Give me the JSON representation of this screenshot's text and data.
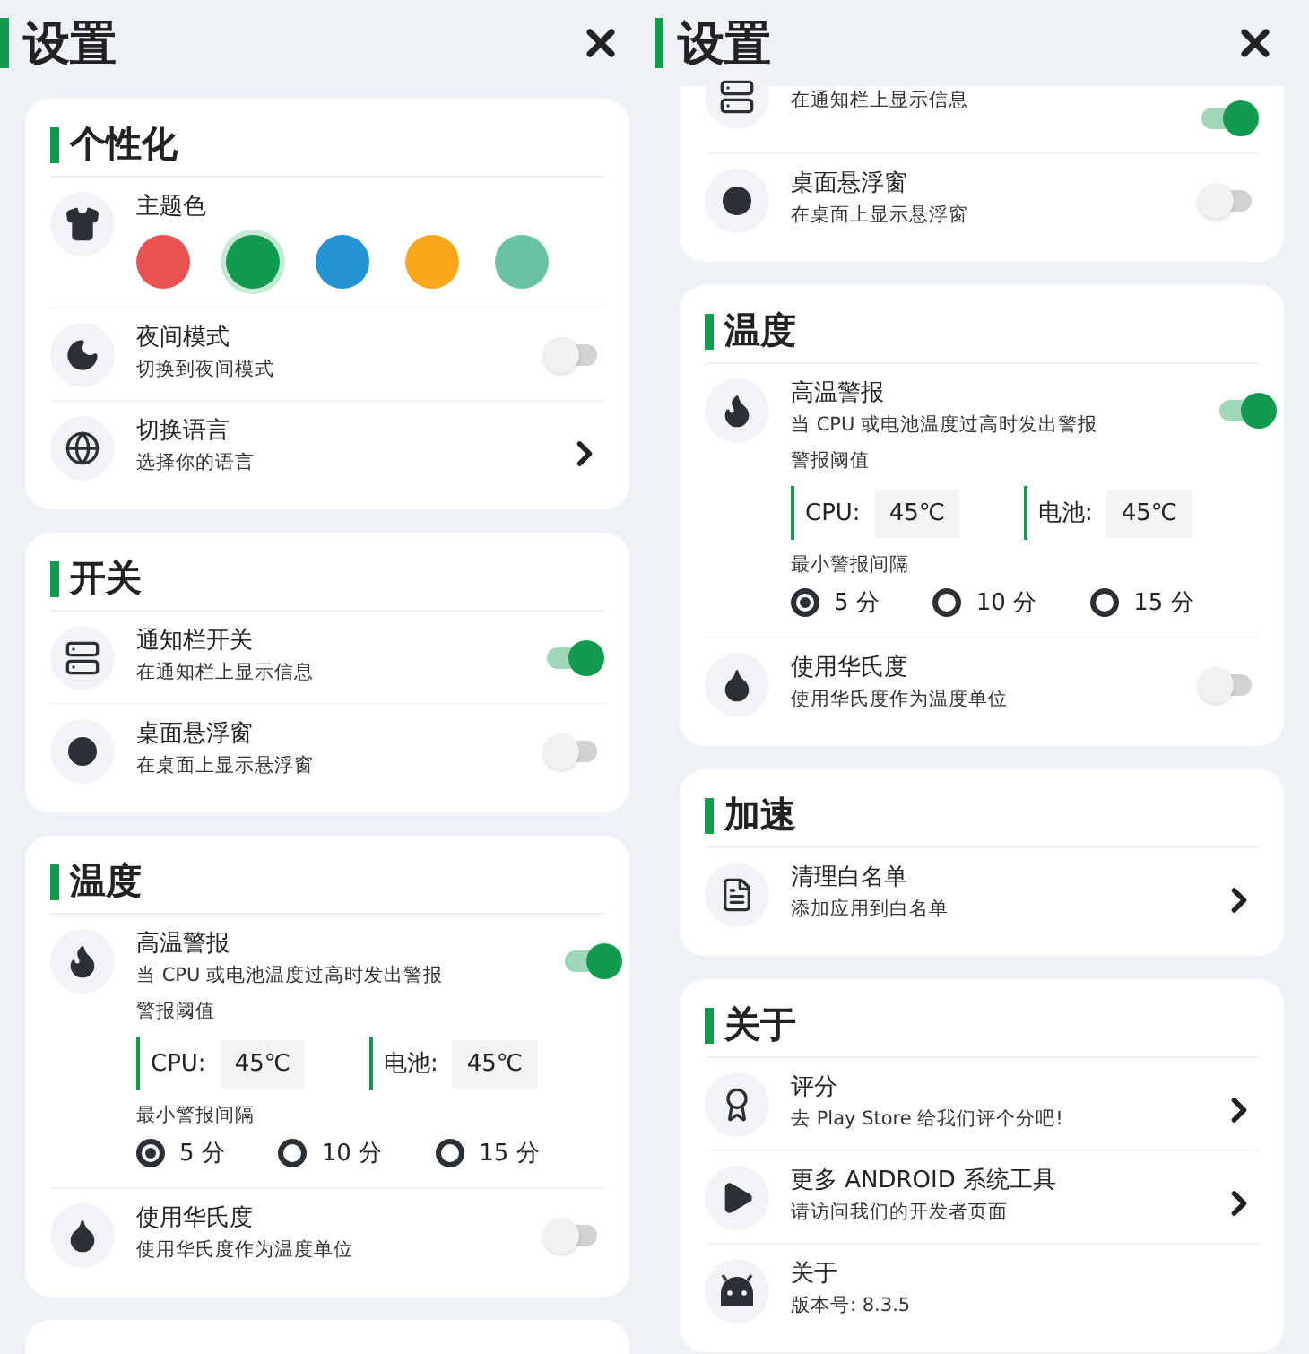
{
  "screens": [
    {
      "title": "设置",
      "sections": [
        {
          "kind": "personal",
          "title": "个性化",
          "rows": [
            {
              "kind": "theme",
              "title": "主题色",
              "swatches": [
                {
                  "color": "#e9524f",
                  "selected": false
                },
                {
                  "color": "#129a4e",
                  "selected": true
                },
                {
                  "color": "#2393d3",
                  "selected": false
                },
                {
                  "color": "#f9a81c",
                  "selected": false
                },
                {
                  "color": "#68c3a3",
                  "selected": false
                }
              ]
            },
            {
              "kind": "toggle",
              "title": "夜间模式",
              "subtitle": "切换到夜间模式",
              "on": false
            },
            {
              "kind": "link",
              "title": "切换语言",
              "subtitle": "选择你的语言"
            }
          ]
        },
        {
          "kind": "switches",
          "title": "开关",
          "rows": [
            {
              "kind": "toggle",
              "title": "通知栏开关",
              "subtitle": "在通知栏上显示信息",
              "on": true
            },
            {
              "kind": "toggle",
              "title": "桌面悬浮窗",
              "subtitle": "在桌面上显示悬浮窗",
              "on": false
            }
          ]
        },
        {
          "kind": "temperature",
          "title": "温度",
          "rows": [
            {
              "kind": "alert",
              "title": "高温警报",
              "subtitle": "当 CPU 或电池温度过高时发出警报",
              "on": true,
              "threshold_label": "警报阈值",
              "fields": [
                {
                  "label": "CPU:",
                  "value": "45℃"
                },
                {
                  "label": "电池:",
                  "value": "45℃"
                }
              ],
              "interval_label": "最小警报间隔",
              "options": [
                {
                  "label": "5 分",
                  "selected": true
                },
                {
                  "label": "10 分",
                  "selected": false
                },
                {
                  "label": "15 分",
                  "selected": false
                }
              ]
            },
            {
              "kind": "toggle",
              "title": "使用华氏度",
              "subtitle": "使用华氏度作为温度单位",
              "on": false
            }
          ]
        },
        {
          "kind": "stub"
        }
      ]
    },
    {
      "title": "设置",
      "sections": [
        {
          "kind": "switches",
          "rows": [
            {
              "kind": "toggle",
              "subtitle": "在通知栏上显示信息",
              "on": true
            },
            {
              "kind": "toggle",
              "title": "桌面悬浮窗",
              "subtitle": "在桌面上显示悬浮窗",
              "on": false
            }
          ]
        },
        {
          "kind": "temperature",
          "title": "温度",
          "rows": [
            {
              "kind": "alert",
              "title": "高温警报",
              "subtitle": "当 CPU 或电池温度过高时发出警报",
              "on": true,
              "threshold_label": "警报阈值",
              "fields": [
                {
                  "label": "CPU:",
                  "value": "45℃"
                },
                {
                  "label": "电池:",
                  "value": "45℃"
                }
              ],
              "interval_label": "最小警报间隔",
              "options": [
                {
                  "label": "5 分",
                  "selected": true
                },
                {
                  "label": "10 分",
                  "selected": false
                },
                {
                  "label": "15 分",
                  "selected": false
                }
              ]
            },
            {
              "kind": "toggle",
              "title": "使用华氏度",
              "subtitle": "使用华氏度作为温度单位",
              "on": false
            }
          ]
        },
        {
          "kind": "speed",
          "title": "加速",
          "rows": [
            {
              "kind": "link",
              "title": "清理白名单",
              "subtitle": "添加应用到白名单"
            }
          ]
        },
        {
          "kind": "about",
          "title": "关于",
          "rows": [
            {
              "kind": "link",
              "title": "评分",
              "subtitle": "去 Play Store 给我们评个分吧!"
            },
            {
              "kind": "link",
              "title": "更多 ANDROID 系统工具",
              "subtitle": "请访问我们的开发者页面"
            },
            {
              "kind": "info",
              "title": "关于",
              "subtitle": "版本号: 8.3.5"
            }
          ]
        }
      ]
    }
  ]
}
